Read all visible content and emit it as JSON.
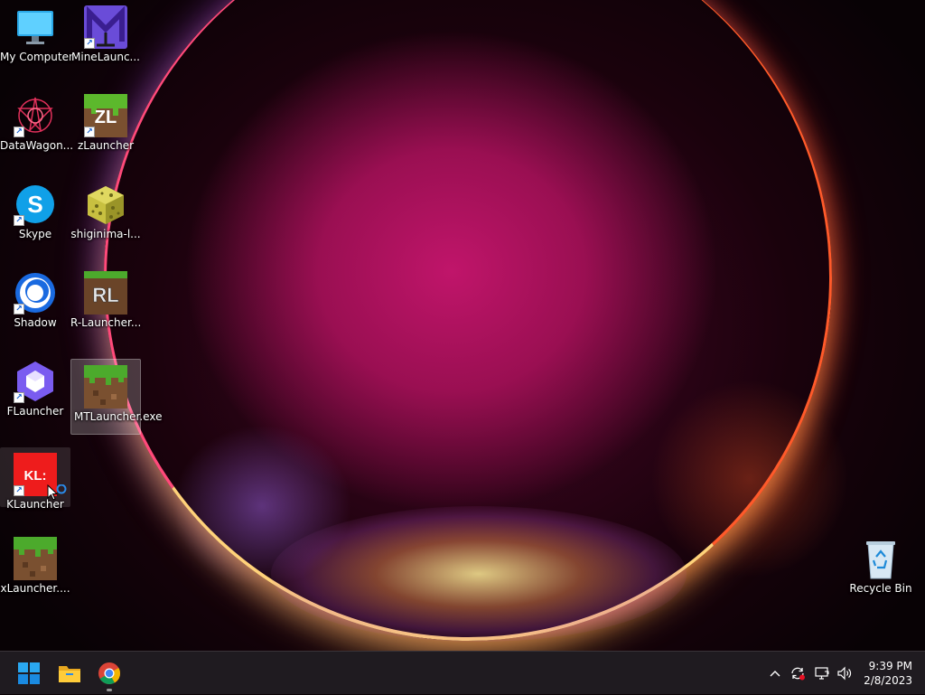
{
  "desktop_icons": [
    {
      "label": "My Computer",
      "icon": "monitor-icon",
      "shortcut": false
    },
    {
      "label": "MineLaunc...",
      "icon": "minelauncher-icon",
      "shortcut": true
    },
    {
      "label": "DataWagon...",
      "icon": "datawagon-icon",
      "shortcut": true
    },
    {
      "label": "zLauncher",
      "icon": "zlauncher-icon",
      "shortcut": true,
      "icon_text": "ZL"
    },
    {
      "label": "Skype",
      "icon": "skype-icon",
      "shortcut": true,
      "icon_text": "S"
    },
    {
      "label": "shiginima-l...",
      "icon": "sponge-block-icon",
      "shortcut": false
    },
    {
      "label": "Shadow",
      "icon": "shadow-icon",
      "shortcut": true
    },
    {
      "label": "R-Launcher...",
      "icon": "rlauncher-icon",
      "shortcut": false,
      "icon_text": "RL"
    },
    {
      "label": "FLauncher",
      "icon": "flauncher-icon",
      "shortcut": true
    },
    {
      "label": "MTLauncher.exe",
      "icon": "grass-block-icon",
      "shortcut": false
    },
    {
      "label": "KLauncher",
      "icon": "klauncher-icon",
      "shortcut": true,
      "icon_text": "KL:"
    },
    {
      "label": "xLauncher....",
      "icon": "grass-block-icon",
      "shortcut": false
    }
  ],
  "recycle_bin": {
    "label": "Recycle Bin",
    "icon": "recycle-bin-icon"
  },
  "taskbar": {
    "pinned": [
      "windows-start-icon",
      "file-explorer-icon",
      "chrome-icon"
    ],
    "tray_icons": [
      "chevron-up-icon",
      "sync-icon",
      "network-icon",
      "volume-icon"
    ],
    "clock": {
      "time": "9:39 PM",
      "date": "2/8/2023"
    }
  },
  "colors": {
    "taskbar_bg": "#1f1b20",
    "accent": "#0078d4"
  }
}
